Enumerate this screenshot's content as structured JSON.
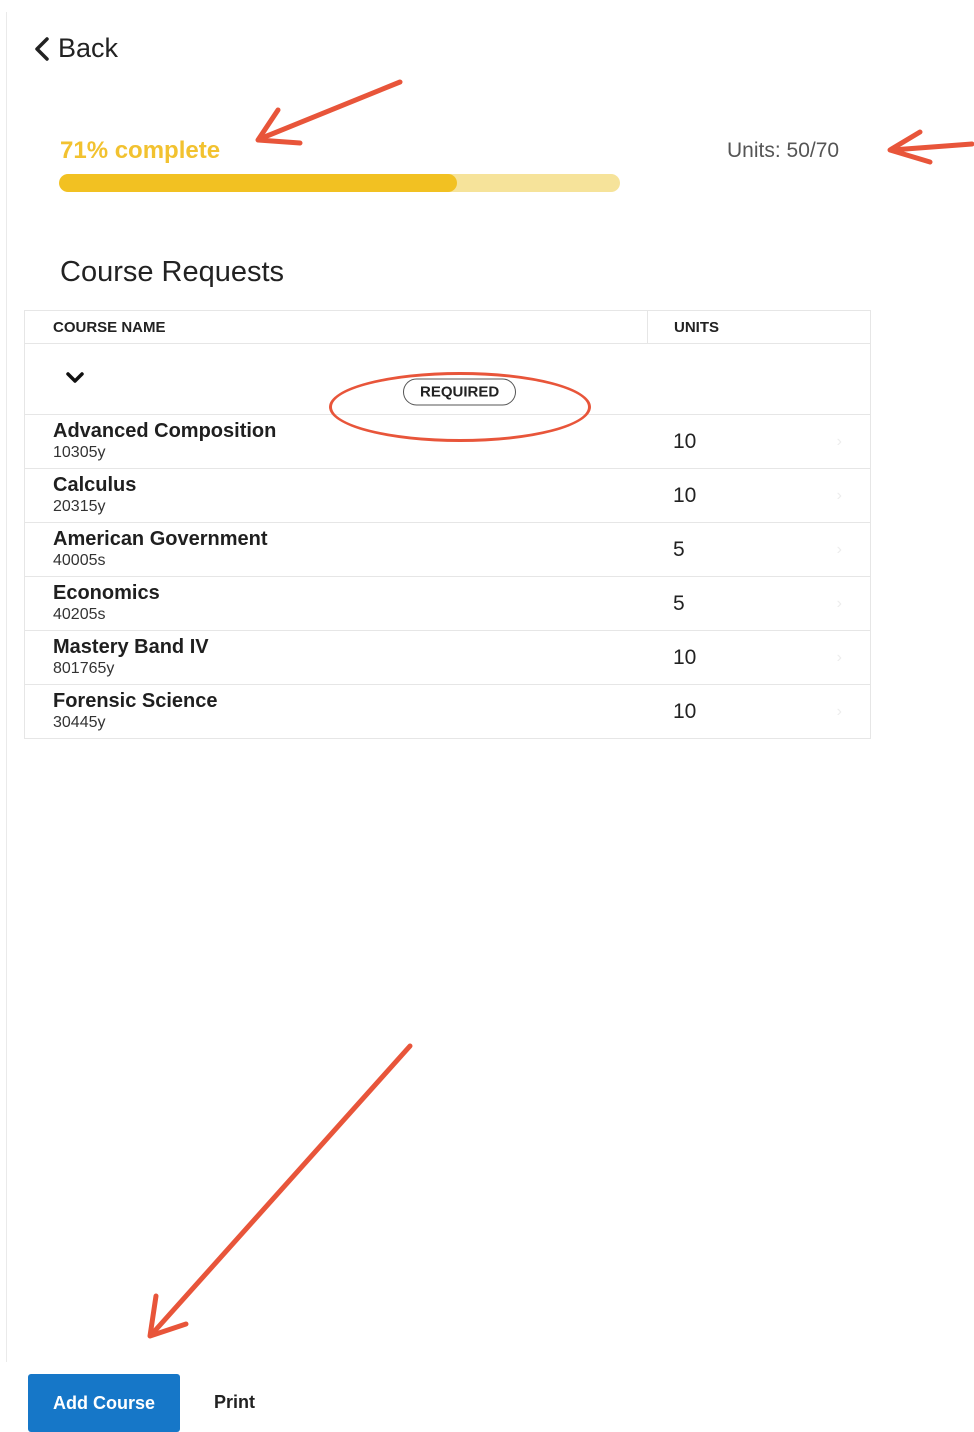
{
  "nav": {
    "back_label": "Back"
  },
  "progress": {
    "label": "71% complete",
    "fraction": 0.71,
    "color": "#f2c122"
  },
  "units_summary": "Units: 50/70",
  "section_title": "Course Requests",
  "table": {
    "headers": {
      "name": "COURSE NAME",
      "units": "UNITS"
    },
    "group_badge": "REQUIRED",
    "rows": [
      {
        "name": "Advanced Composition",
        "code": "10305y",
        "units": "10"
      },
      {
        "name": "Calculus",
        "code": "20315y",
        "units": "10"
      },
      {
        "name": "American Government",
        "code": "40005s",
        "units": "5"
      },
      {
        "name": "Economics",
        "code": "40205s",
        "units": "5"
      },
      {
        "name": "Mastery Band IV",
        "code": "801765y",
        "units": "10"
      },
      {
        "name": "Forensic Science",
        "code": "30445y",
        "units": "10"
      }
    ]
  },
  "actions": {
    "add_course_label": "Add Course",
    "print_label": "Print"
  },
  "colors": {
    "accent": "#1677c8",
    "annotation": "#e8553a",
    "progress": "#f2c122"
  }
}
